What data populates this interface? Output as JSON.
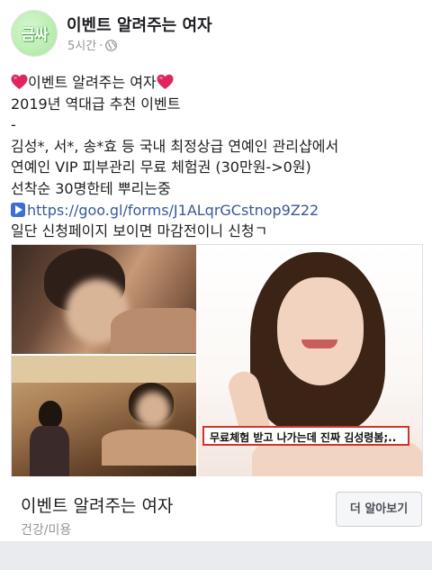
{
  "header": {
    "avatar_text": "금싸",
    "page_name": "이벤트 알려주는 여자",
    "timestamp": "5시간",
    "separator": "·",
    "privacy_icon": "globe-icon"
  },
  "post": {
    "line1_text": "이벤트 알려주는 여자",
    "line2": "2019년 역대급 추천 이벤트",
    "line3": "-",
    "line4": "김성*, 서*, 송*효 등 국내 최정상급 연예인 관리샵에서",
    "line5": "연예인 VIP 피부관리 무료 체험권 (30만원->0원)",
    "line6": "선착순 30명한테 뿌리는중",
    "link": "https://goo.gl/forms/J1ALqrGCstnop9Z22",
    "line8": "일단 신청페이지 보이면 마감전이니 신청ㄱ",
    "heart_color": "#e0245e",
    "link_icon": "play-icon"
  },
  "media": {
    "caption": "무료체험 받고 나가는데 진짜 김성령봄;.."
  },
  "footer": {
    "title": "이벤트 알려주는 여자",
    "category": "건강/미용",
    "cta_label": "더 알아보기"
  }
}
